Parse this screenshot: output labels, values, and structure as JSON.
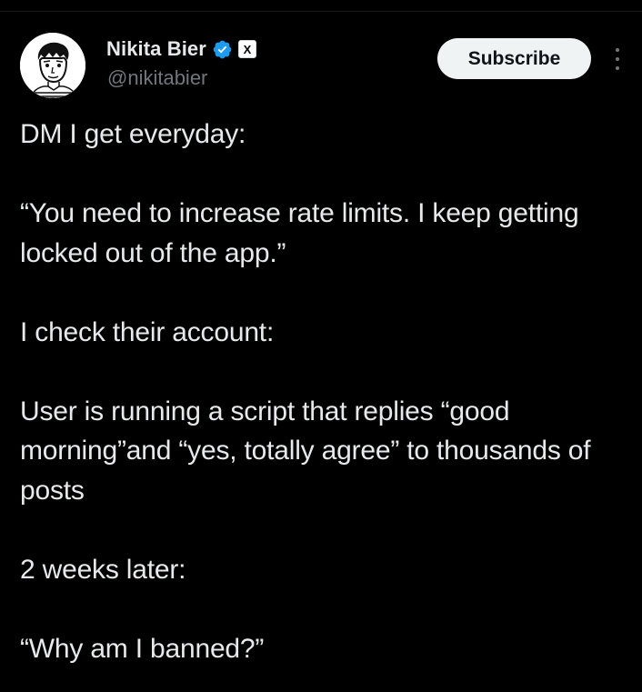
{
  "author": {
    "display_name": "Nikita Bier",
    "handle": "@nikitabier",
    "verified": true,
    "affiliate_badge": "X",
    "avatar_icon": "sketch-portrait-avatar"
  },
  "actions": {
    "subscribe_label": "Subscribe",
    "more_icon": "vertical-ellipsis-icon"
  },
  "tweet": {
    "paragraphs": [
      "DM I get everyday:",
      "“You need to increase rate limits. I keep getting locked out of the app.”",
      "I check their account:",
      "User is running a script that replies “good morning”and “yes, totally agree” to thousands of posts",
      "2 weeks later:",
      "“Why am I banned?”"
    ]
  },
  "colors": {
    "background": "#000000",
    "text_primary": "#e7e9ea",
    "text_secondary": "#71767b",
    "verified_blue": "#1d9bf0",
    "button_bg": "#eff3f4"
  }
}
